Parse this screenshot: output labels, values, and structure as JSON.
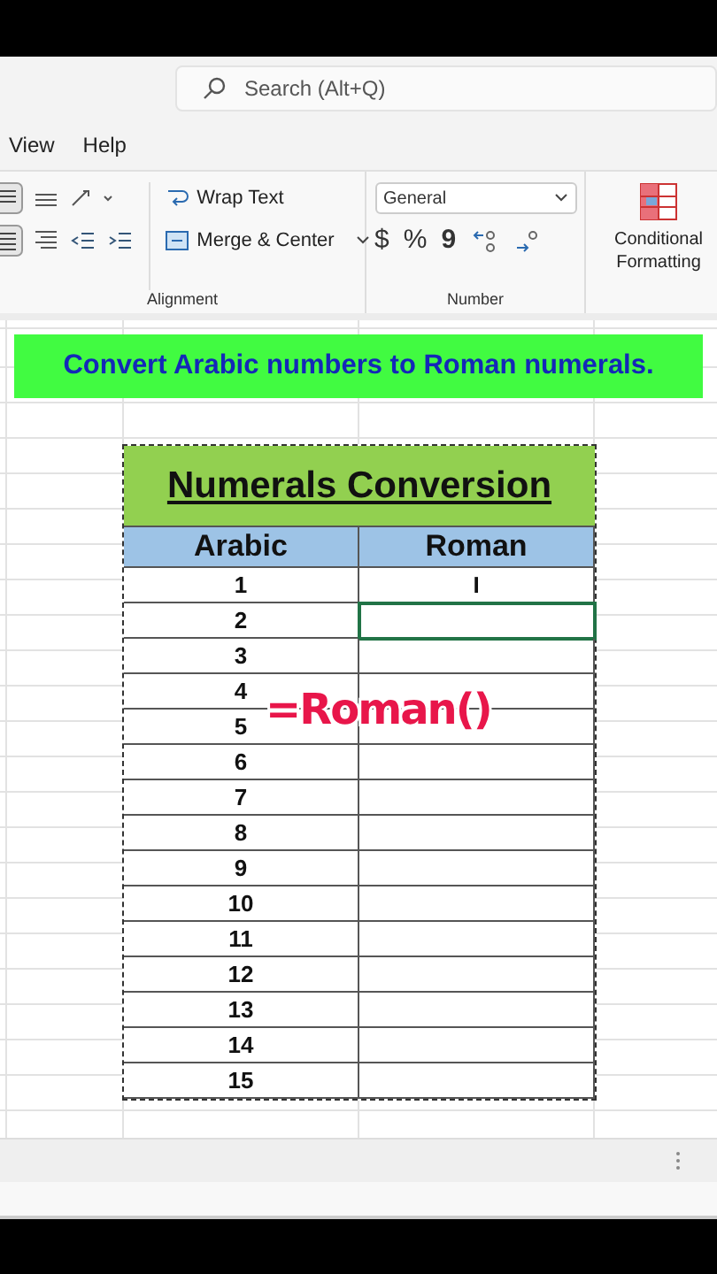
{
  "search": {
    "placeholder": "Search (Alt+Q)"
  },
  "menu": [
    {
      "label": "View"
    },
    {
      "label": "Help"
    }
  ],
  "ribbon": {
    "alignment": {
      "wrap_text": "Wrap Text",
      "merge_center": "Merge & Center",
      "label": "Alignment"
    },
    "number": {
      "format": "General",
      "currency": "$",
      "percent": "%",
      "comma": "9",
      "label": "Number"
    },
    "styles": {
      "conditional_formatting": "Conditional Formatting"
    }
  },
  "banner": "Convert Arabic numbers to Roman numerals.",
  "table": {
    "title": "Numerals Conversion",
    "columns": [
      "Arabic",
      "Roman"
    ],
    "rows": [
      {
        "arabic": "1",
        "roman": "I",
        "selected": false
      },
      {
        "arabic": "2",
        "roman": "",
        "selected": true
      },
      {
        "arabic": "3",
        "selected": false
      },
      {
        "arabic": "4",
        "selected": false
      },
      {
        "arabic": "5",
        "selected": false
      },
      {
        "arabic": "6",
        "selected": false
      },
      {
        "arabic": "7",
        "selected": false
      },
      {
        "arabic": "8",
        "selected": false
      },
      {
        "arabic": "9",
        "selected": false
      },
      {
        "arabic": "10",
        "selected": false
      },
      {
        "arabic": "11",
        "selected": false
      },
      {
        "arabic": "12",
        "selected": false
      },
      {
        "arabic": "13",
        "selected": false
      },
      {
        "arabic": "14",
        "selected": false
      },
      {
        "arabic": "15",
        "selected": false
      }
    ]
  },
  "formula_overlay": "=Roman()"
}
